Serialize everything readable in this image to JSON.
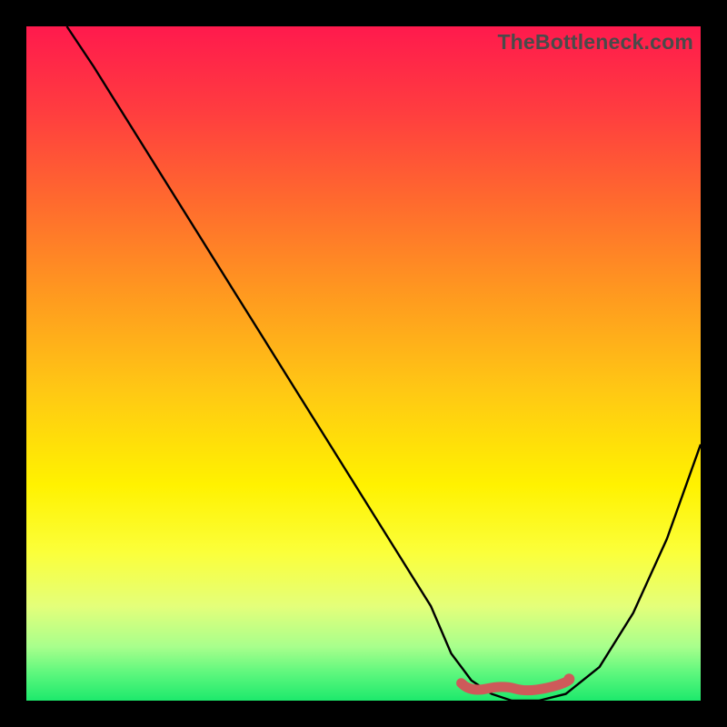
{
  "watermark": "TheBottleneck.com",
  "chart_data": {
    "type": "line",
    "title": "",
    "xlabel": "",
    "ylabel": "",
    "xlim": [
      0,
      100
    ],
    "ylim": [
      0,
      100
    ],
    "series": [
      {
        "name": "bottleneck-curve",
        "x": [
          6,
          10,
          15,
          20,
          25,
          30,
          35,
          40,
          45,
          50,
          55,
          60,
          63,
          66,
          69,
          72,
          76,
          80,
          85,
          90,
          95,
          100
        ],
        "y": [
          100,
          94,
          86,
          78,
          70,
          62,
          54,
          46,
          38,
          30,
          22,
          14,
          7,
          3,
          1,
          0,
          0,
          1,
          5,
          13,
          24,
          38
        ]
      }
    ],
    "markers": [
      {
        "name": "low-band-left",
        "x": 64.5,
        "y": 2.2
      },
      {
        "name": "low-band-right",
        "x": 80.5,
        "y": 2.4
      }
    ],
    "marker_path_label": "",
    "colors": {
      "curve": "#000000",
      "marker": "#ce5a5a",
      "gradient_top": "#ff1a4d",
      "gradient_bottom": "#1de96c"
    }
  }
}
